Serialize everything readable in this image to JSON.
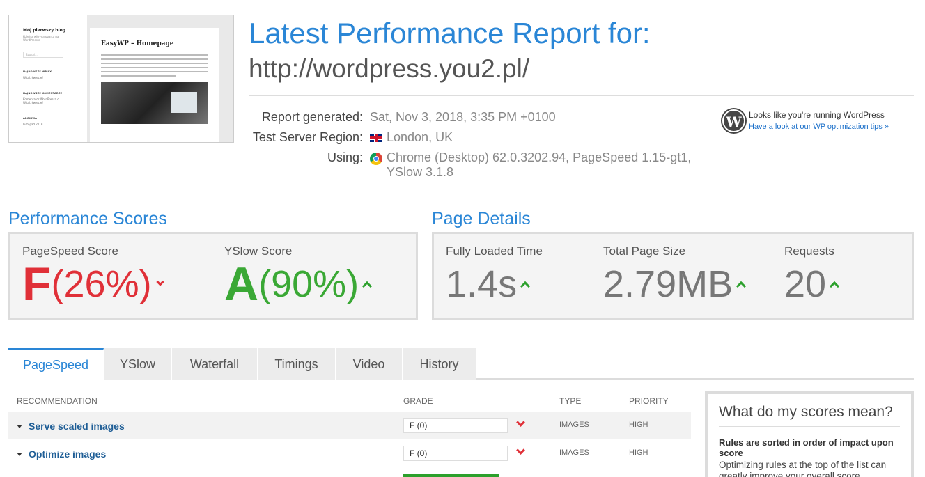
{
  "thumbnail": {
    "blog_title": "Mój pierwszy blog",
    "blog_tagline": "Kolejna witryna oparta na WordPressie",
    "search_placeholder": "Szukaj...",
    "widget1_heading": "NAJNOWSZE WPISY",
    "widget1_text": "Witaj, świecie!",
    "widget2_heading": "NAJNOWSZE KOMENTARZE",
    "widget2_text": "Komentator WordPressa o Witaj, świecie!",
    "widget3_heading": "ARCHIWA",
    "widget3_text": "Listopad 2018",
    "page_title": "EasyWP – Homepage"
  },
  "header": {
    "title": "Latest Performance Report for:",
    "url": "http://wordpress.you2.pl/"
  },
  "meta": {
    "generated_label": "Report generated:",
    "generated_value": "Sat, Nov 3, 2018, 3:35 PM +0100",
    "region_label": "Test Server Region:",
    "region_value": "London, UK",
    "using_label": "Using:",
    "using_value": "Chrome (Desktop) 62.0.3202.94, PageSpeed 1.15-gt1, YSlow 3.1.8"
  },
  "wordpress": {
    "note": "Looks like you're running WordPress",
    "link": "Have a look at our WP optimization tips »",
    "logo_letter": "W"
  },
  "performance": {
    "heading": "Performance Scores",
    "pagespeed_label": "PageSpeed Score",
    "pagespeed_grade": "F",
    "pagespeed_pct": "(26%)",
    "yslow_label": "YSlow Score",
    "yslow_grade": "A",
    "yslow_pct": "(90%)"
  },
  "details": {
    "heading": "Page Details",
    "loaded_label": "Fully Loaded Time",
    "loaded_value": "1.4s",
    "size_label": "Total Page Size",
    "size_value": "2.79MB",
    "requests_label": "Requests",
    "requests_value": "20"
  },
  "tabs": [
    "PageSpeed",
    "YSlow",
    "Waterfall",
    "Timings",
    "Video",
    "History"
  ],
  "table": {
    "headers": {
      "recommendation": "RECOMMENDATION",
      "grade": "GRADE",
      "type": "TYPE",
      "priority": "PRIORITY"
    },
    "rows": [
      {
        "recommendation": "Serve scaled images",
        "grade": "F (0)",
        "type": "IMAGES",
        "priority": "HIGH"
      },
      {
        "recommendation": "Optimize images",
        "grade": "F (0)",
        "type": "IMAGES",
        "priority": "HIGH"
      }
    ]
  },
  "sidebar": {
    "title": "What do my scores mean?",
    "bold": "Rules are sorted in order of impact upon score",
    "text": "Optimizing rules at the top of the list can greatly improve your overall score."
  },
  "colors": {
    "accent": "#2a86d6",
    "bad": "#e03038",
    "good": "#3aa835"
  }
}
